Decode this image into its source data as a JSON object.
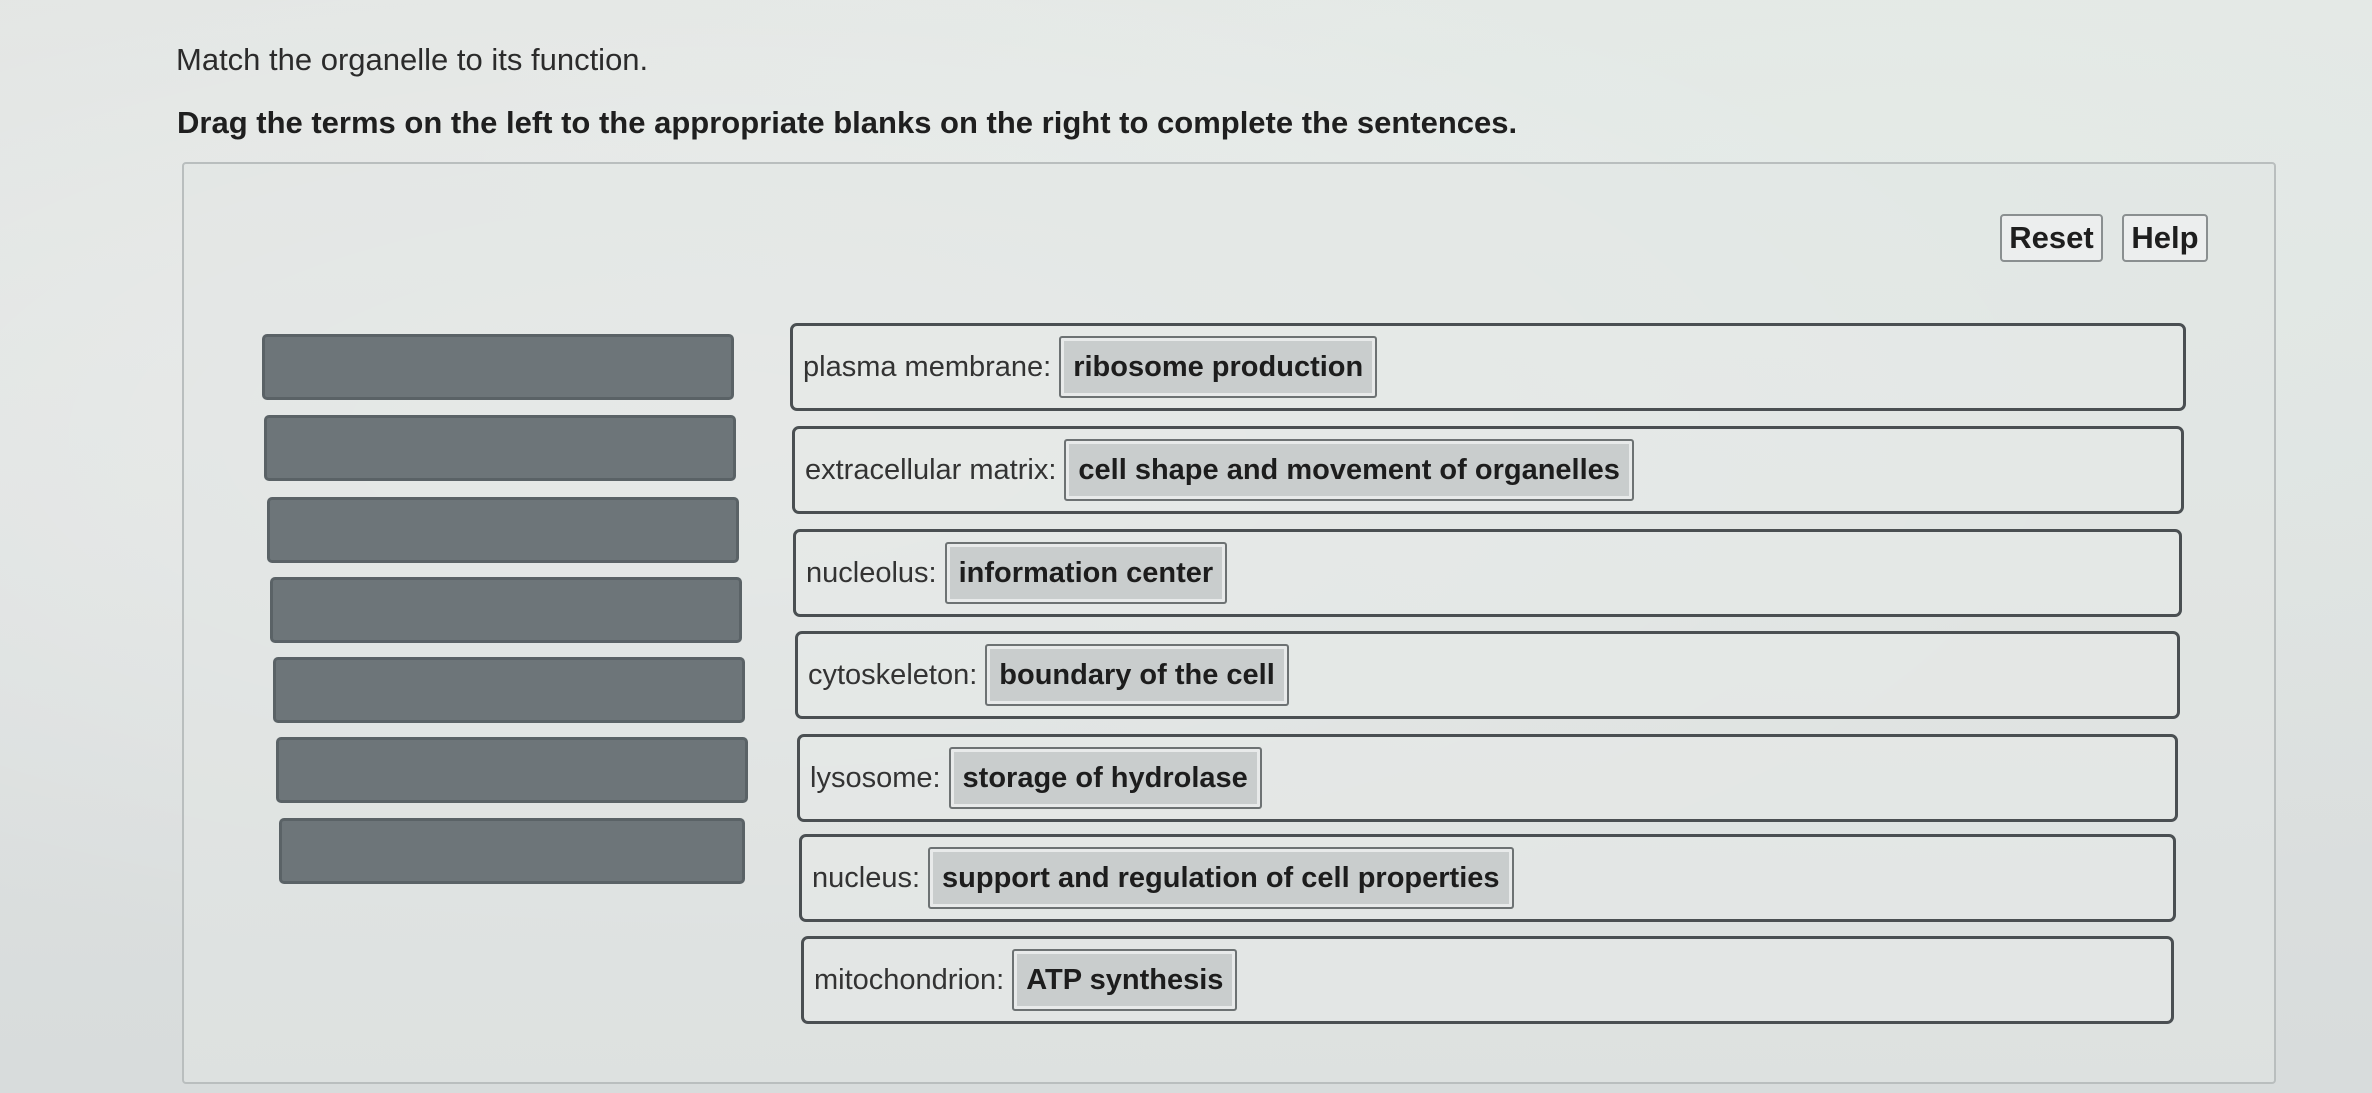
{
  "question": {
    "instruction": "Match the organelle to its function.",
    "directions": "Drag the terms on the left to the appropriate blanks on the right to complete the sentences."
  },
  "toolbar": {
    "reset_label": "Reset",
    "help_label": "Help"
  },
  "term_bank": {
    "empty_slot_count": 7
  },
  "rows": [
    {
      "label": "plasma membrane:",
      "answer": "ribosome production"
    },
    {
      "label": "extracellular matrix:",
      "answer": "cell shape and movement of organelles"
    },
    {
      "label": "nucleolus:",
      "answer": "information center"
    },
    {
      "label": "cytoskeleton:",
      "answer": "boundary of the cell"
    },
    {
      "label": "lysosome:",
      "answer": "storage of hydrolase"
    },
    {
      "label": "nucleus:",
      "answer": "support and regulation of cell properties"
    },
    {
      "label": "mitochondrion:",
      "answer": "ATP synthesis"
    }
  ]
}
